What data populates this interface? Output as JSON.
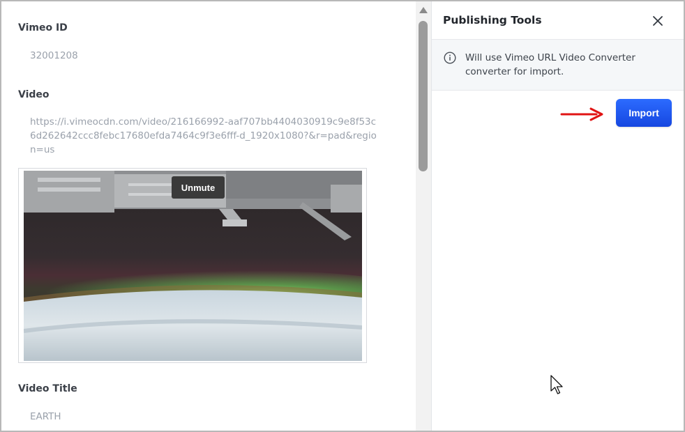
{
  "form": {
    "vimeo_id_label": "Vimeo ID",
    "vimeo_id_value": "32001208",
    "video_label": "Video",
    "video_url": "https://i.vimeocdn.com/video/216166992-aaf707bb4404030919c9e8f53c6d262642ccc8febc17680efda7464c9f3e6fff-d_1920x1080?&r=pad&region=us",
    "video_title_label": "Video Title",
    "video_title_value": "EARTH"
  },
  "player": {
    "unmute_label": "Unmute"
  },
  "panel": {
    "title": "Publishing Tools",
    "info_text": "Will use Vimeo URL Video Converter converter for import.",
    "import_label": "Import"
  },
  "colors": {
    "accent": "#1e55f0",
    "arrow": "#e01414",
    "muted_text": "#9aa1ab"
  },
  "icons": {
    "close": "close-icon",
    "info": "info-icon",
    "scroll_up": "chevron-up-icon",
    "arrow": "arrow-right-icon",
    "cursor": "mouse-cursor-icon"
  }
}
